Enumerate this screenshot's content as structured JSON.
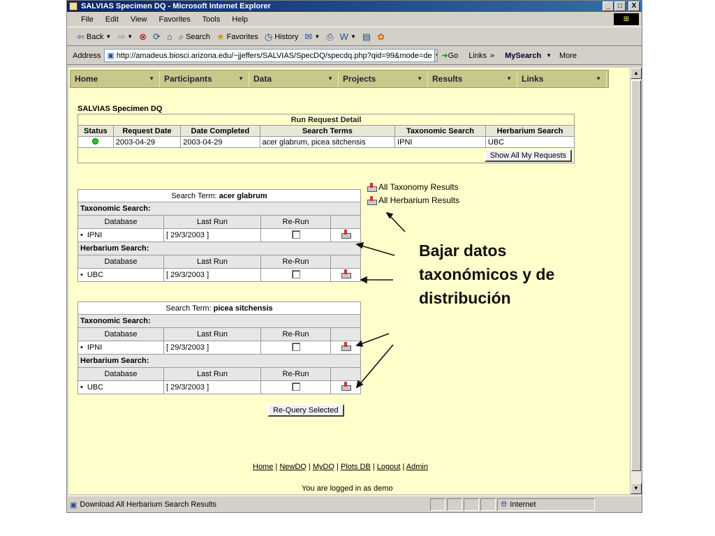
{
  "window": {
    "title": "SALVIAS Specimen DQ - Microsoft Internet Explorer",
    "min": "_",
    "max": "□",
    "close": "X"
  },
  "menu": [
    "File",
    "Edit",
    "View",
    "Favorites",
    "Tools",
    "Help"
  ],
  "toolbar": {
    "back": "Back",
    "search": "Search",
    "favorites": "Favorites",
    "history": "History"
  },
  "address": {
    "label": "Address",
    "url": "http://amadeus.biosci.arizona.edu/~jjeffers/SALVIAS/SpecDQ/specdq.php?qid=99&mode=de",
    "go": "Go",
    "links": "Links",
    "mysearch": "MySearch",
    "more": "More"
  },
  "nav": [
    "Home",
    "Participants",
    "Data",
    "Projects",
    "Results",
    "Links"
  ],
  "page": {
    "title": "SALVIAS Specimen DQ",
    "run_request": {
      "heading": "Run Request Detail",
      "columns": [
        "Status",
        "Request Date",
        "Date Completed",
        "Search Terms",
        "Taxonomic Search",
        "Herbarium Search"
      ],
      "row": {
        "request_date": "2003-04-29",
        "date_completed": "2003-04-29",
        "search_terms": "acer glabrum, picea sitchensis",
        "taxonomic": "IPNI",
        "herbarium": "UBC"
      },
      "show_all": "Show All My Requests"
    },
    "download_links": [
      "All Taxonomy Results",
      "All Herbarium Results"
    ],
    "search_terms": [
      {
        "prefix": "Search Term:",
        "term": "acer glabrum",
        "tax_label": "Taxonomic Search:",
        "herb_label": "Herbarium Search:",
        "cols": [
          "Database",
          "Last Run",
          "Re-Run"
        ],
        "tax_db": "IPNI",
        "tax_run": "[ 29/3/2003 ]",
        "herb_db": "UBC",
        "herb_run": "[ 29/3/2003 ]"
      },
      {
        "prefix": "Search Term:",
        "term": "picea sitchensis",
        "tax_label": "Taxonomic Search:",
        "herb_label": "Herbarium Search:",
        "cols": [
          "Database",
          "Last Run",
          "Re-Run"
        ],
        "tax_db": "IPNI",
        "tax_run": "[ 29/3/2003 ]",
        "herb_db": "UBC",
        "herb_run": "[ 29/3/2003 ]"
      }
    ],
    "requery": "Re-Query Selected",
    "footer": [
      "Home",
      "NewDQ",
      "MyDQ",
      "Plots DB",
      "Logout",
      "Admin"
    ],
    "logged": "You are logged in as demo"
  },
  "annotation": {
    "line1": "Bajar datos",
    "line2": "taxonómicos y de",
    "line3": "distribución"
  },
  "status": {
    "text": "Download All Herbarium Search Results",
    "zone": "Internet"
  }
}
